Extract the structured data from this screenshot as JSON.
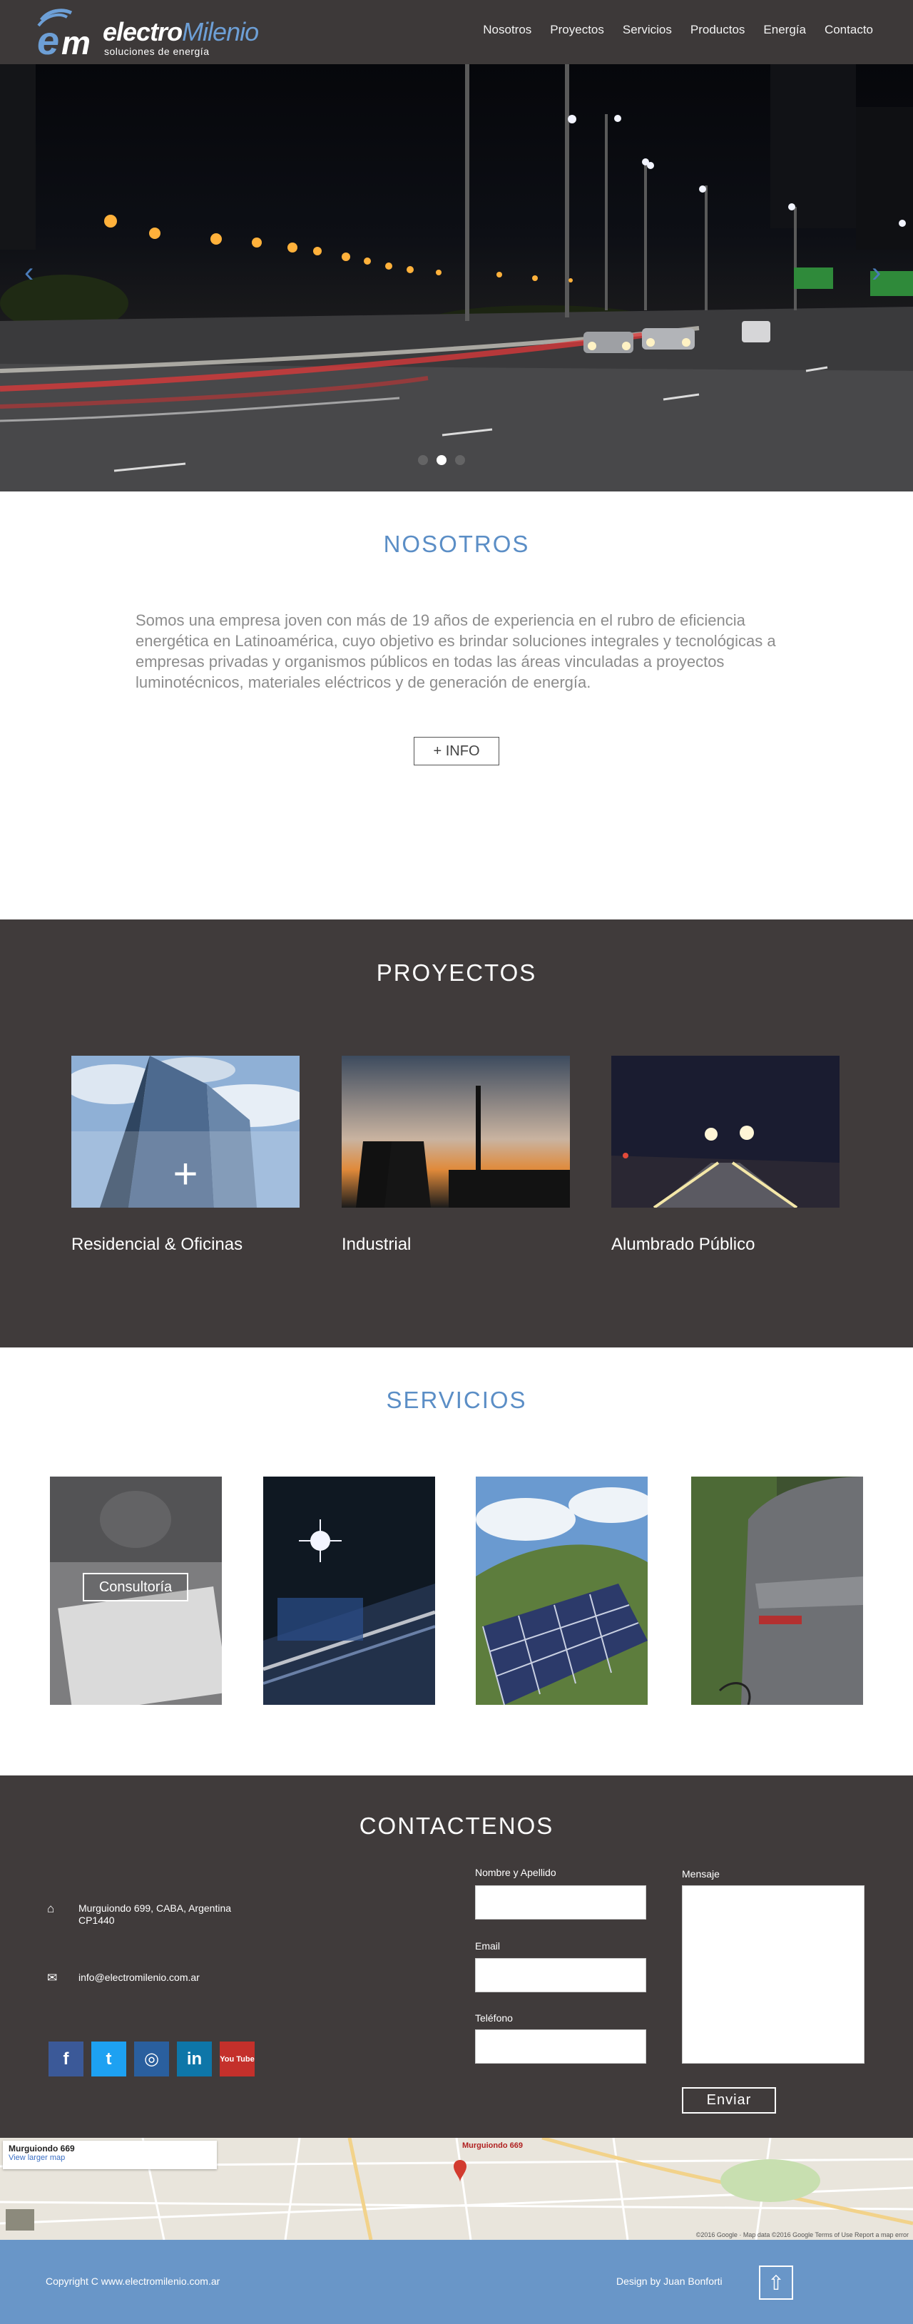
{
  "header": {
    "logo": {
      "brand_main": "electro",
      "brand_accent": "Milenio",
      "tagline": "soluciones de energía"
    },
    "nav": [
      {
        "label": "Nosotros"
      },
      {
        "label": "Proyectos"
      },
      {
        "label": "Servicios"
      },
      {
        "label": "Productos"
      },
      {
        "label": "Energía"
      },
      {
        "label": "Contacto"
      }
    ]
  },
  "hero": {
    "prev_icon": "chevron-left-icon",
    "next_icon": "chevron-right-icon",
    "slides_count": 3,
    "active_slide": 2
  },
  "nosotros": {
    "title": "NOSOTROS",
    "body": "Somos una empresa joven con más de 19 años de experiencia en el rubro de eficiencia energética en Latinoamérica, cuyo objetivo es brindar soluciones integrales y tecnológicas a empresas privadas y organismos públicos en todas las áreas vinculadas a proyectos luminotécnicos, materiales eléctricos y de  generación de energía.",
    "button": "+ INFO"
  },
  "proyectos": {
    "title": "PROYECTOS",
    "items": [
      {
        "label": "Residencial & Oficinas"
      },
      {
        "label": "Industrial"
      },
      {
        "label": "Alumbrado Público"
      }
    ]
  },
  "servicios": {
    "title": "SERVICIOS",
    "items": [
      {
        "label": "Consultoría"
      }
    ]
  },
  "contacto": {
    "title": "CONTACTENOS",
    "address_line1": "Murguiondo 699, CABA, Argentina",
    "address_line2": "CP1440",
    "email": "info@electromilenio.com.ar",
    "form": {
      "name_label": "Nombre y Apellido",
      "email_label": "Email",
      "phone_label": "Teléfono",
      "message_label": "Mensaje",
      "send": "Enviar"
    },
    "socials": [
      {
        "icon": "facebook-icon",
        "glyph": "f",
        "color": "#3b5998"
      },
      {
        "icon": "twitter-icon",
        "glyph": "t",
        "color": "#1da1f2"
      },
      {
        "icon": "instagram-icon",
        "glyph": "◎",
        "color": "#2a5f9e"
      },
      {
        "icon": "linkedin-icon",
        "glyph": "in",
        "color": "#0e76a8"
      },
      {
        "icon": "youtube-icon",
        "glyph": "You Tube",
        "color": "#c4302b"
      }
    ]
  },
  "map": {
    "place": "Murguiondo 669",
    "link": "View larger map",
    "pin_label": "Murguiondo 669",
    "footer_text": "©2016 Google · Map data ©2016 Google    Terms of Use    Report a map error"
  },
  "footer": {
    "copyright": "Copyright C  www.electromilenio.com.ar",
    "design": "Design by Juan Bonforti"
  }
}
